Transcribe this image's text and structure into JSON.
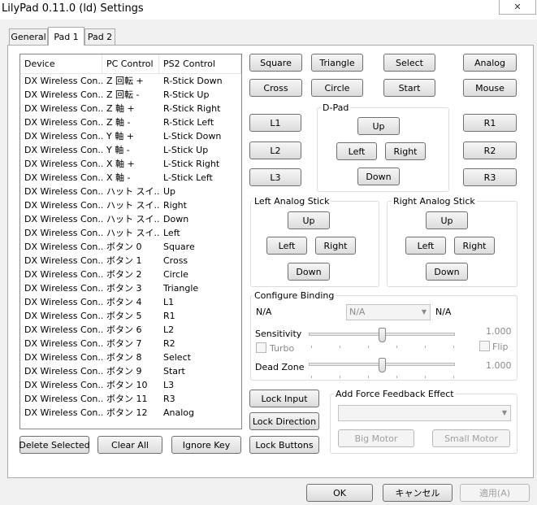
{
  "window": {
    "title": "LilyPad 0.11.0 (ld) Settings",
    "close_glyph": "✕"
  },
  "tabs": [
    {
      "label": "General"
    },
    {
      "label": "Pad 1"
    },
    {
      "label": "Pad 2"
    }
  ],
  "bindings": {
    "headers": [
      "Device",
      "PC Control",
      "PS2 Control"
    ],
    "rows": [
      [
        "DX Wireless Con...",
        "Z 回転 +",
        "R-Stick Down"
      ],
      [
        "DX Wireless Con...",
        "Z 回転 -",
        "R-Stick Up"
      ],
      [
        "DX Wireless Con...",
        "Z 軸 +",
        "R-Stick Right"
      ],
      [
        "DX Wireless Con...",
        "Z 軸 -",
        "R-Stick Left"
      ],
      [
        "DX Wireless Con...",
        "Y 軸 +",
        "L-Stick Down"
      ],
      [
        "DX Wireless Con...",
        "Y 軸 -",
        "L-Stick Up"
      ],
      [
        "DX Wireless Con...",
        "X 軸 +",
        "L-Stick Right"
      ],
      [
        "DX Wireless Con...",
        "X 軸 -",
        "L-Stick Left"
      ],
      [
        "DX Wireless Con...",
        "ハット スイ...",
        "Up"
      ],
      [
        "DX Wireless Con...",
        "ハット スイ...",
        "Right"
      ],
      [
        "DX Wireless Con...",
        "ハット スイ...",
        "Down"
      ],
      [
        "DX Wireless Con...",
        "ハット スイ...",
        "Left"
      ],
      [
        "DX Wireless Con...",
        "ボタン 0",
        "Square"
      ],
      [
        "DX Wireless Con...",
        "ボタン 1",
        "Cross"
      ],
      [
        "DX Wireless Con...",
        "ボタン 2",
        "Circle"
      ],
      [
        "DX Wireless Con...",
        "ボタン 3",
        "Triangle"
      ],
      [
        "DX Wireless Con...",
        "ボタン 4",
        "L1"
      ],
      [
        "DX Wireless Con...",
        "ボタン 5",
        "R1"
      ],
      [
        "DX Wireless Con...",
        "ボタン 6",
        "L2"
      ],
      [
        "DX Wireless Con...",
        "ボタン 7",
        "R2"
      ],
      [
        "DX Wireless Con...",
        "ボタン 8",
        "Select"
      ],
      [
        "DX Wireless Con...",
        "ボタン 9",
        "Start"
      ],
      [
        "DX Wireless Con...",
        "ボタン 10",
        "L3"
      ],
      [
        "DX Wireless Con...",
        "ボタン 11",
        "R3"
      ],
      [
        "DX Wireless Con...",
        "ボタン 12",
        "Analog"
      ]
    ]
  },
  "list_buttons": {
    "delete_selected": "Delete Selected",
    "clear_all": "Clear All",
    "ignore_key": "Ignore Key"
  },
  "pad_buttons": {
    "square": "Square",
    "triangle": "Triangle",
    "select": "Select",
    "analog": "Analog",
    "cross": "Cross",
    "circle": "Circle",
    "start": "Start",
    "mouse": "Mouse",
    "l1": "L1",
    "l2": "L2",
    "l3": "L3",
    "r1": "R1",
    "r2": "R2",
    "r3": "R3"
  },
  "dpad": {
    "title": "D-Pad",
    "up": "Up",
    "left": "Left",
    "right": "Right",
    "down": "Down"
  },
  "left_stick": {
    "title": "Left Analog Stick",
    "up": "Up",
    "left": "Left",
    "right": "Right",
    "down": "Down"
  },
  "right_stick": {
    "title": "Right Analog Stick",
    "up": "Up",
    "left": "Left",
    "right": "Right",
    "down": "Down"
  },
  "configure_binding": {
    "title": "Configure Binding",
    "binding_left": "N/A",
    "combo_value": "N/A",
    "binding_right": "N/A",
    "sensitivity_label": "Sensitivity",
    "sensitivity_value": "1.000",
    "sensitivity_level": 0.5,
    "turbo_label": "Turbo",
    "flip_label": "Flip",
    "deadzone_label": "Dead Zone",
    "deadzone_value": "1.000",
    "deadzone_level": 0.5
  },
  "lock_buttons": {
    "lock_input": "Lock Input",
    "lock_direction": "Lock Direction",
    "lock_buttons": "Lock Buttons"
  },
  "force_feedback": {
    "title": "Add Force Feedback Effect",
    "combo_value": "",
    "big_motor": "Big Motor",
    "small_motor": "Small Motor"
  },
  "dialog_buttons": {
    "ok": "OK",
    "cancel": "キャンセル",
    "apply": "適用(A)"
  }
}
